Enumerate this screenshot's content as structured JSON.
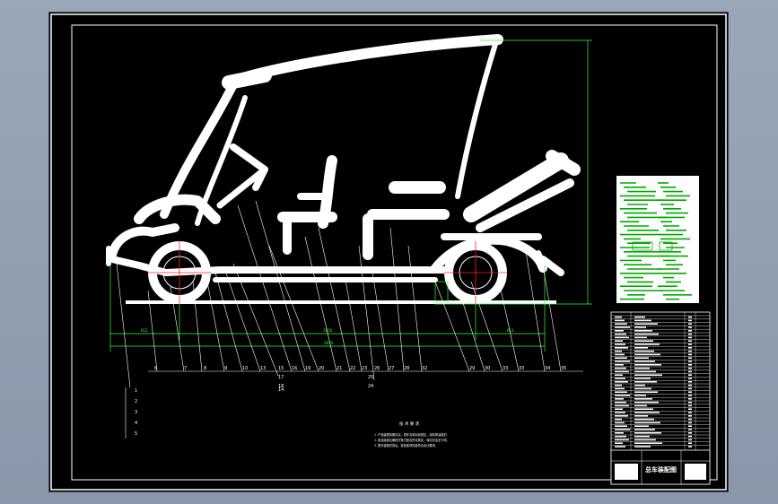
{
  "drawing": {
    "colors": {
      "background": "#000000",
      "outline": "#ffffff",
      "dimension": "#33ff33",
      "axis": "#ff2020",
      "viewport": "#8a97aa"
    },
    "balloon_labels_row": [
      "6",
      "7",
      "8",
      "9",
      "10",
      "13",
      "15",
      "16",
      "14",
      "19",
      "20",
      "21",
      "22",
      "23",
      "26",
      "27",
      "28",
      "32",
      "29",
      "30",
      "33",
      "33",
      "34",
      "35"
    ],
    "balloon_labels_sub": [
      "17",
      "18",
      "25",
      "24"
    ],
    "balloon_labels_col": [
      "1",
      "2",
      "3",
      "4",
      "5"
    ],
    "dimensions": {
      "front_overhang": "612",
      "wheelbase": "1650",
      "rear_overhang": "612",
      "overall_length": "2874"
    },
    "tech_requirements_title": "技 术 要 求",
    "tech_requirements": [
      "1. 产品装配前要清洁，零件去除毛刺锐边，涂防锈油保护。",
      "2. 各连接部位螺栓拧紧力矩应符合规定，转向灵活无卡滞。",
      "3. 整车装配完成后，检验各项性能符合设计要求。"
    ],
    "title_block": {
      "drawing_title": "总车装配图"
    }
  }
}
